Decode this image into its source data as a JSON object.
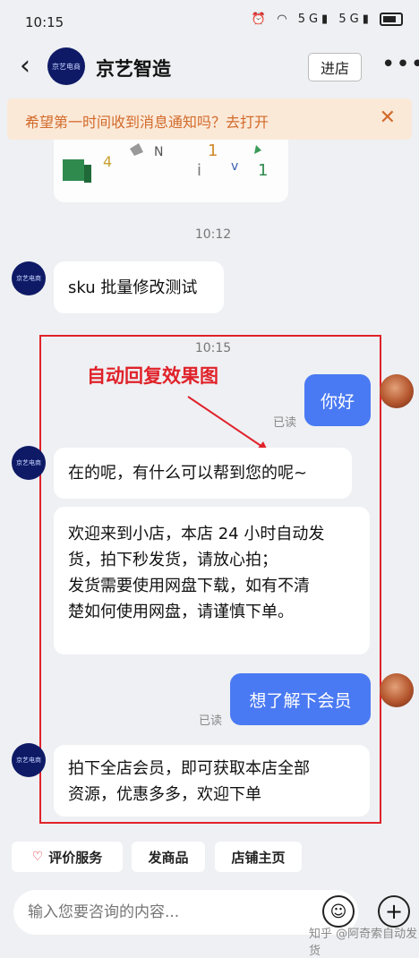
{
  "status": {
    "time": "10:15",
    "signal": "5G",
    "signal2": "5G"
  },
  "header": {
    "back": "‹",
    "shop_name": "京艺智造",
    "avatar_text": "京艺电商",
    "enter_label": "进店",
    "more": "•••"
  },
  "notify": {
    "text": "希望第一时间收到消息通知吗？去打开",
    "close": "✕"
  },
  "messages": {
    "ts1": "10:12",
    "msg1": "sku 批量修改测试",
    "ts2": "10:15",
    "me1": "你好",
    "read1": "已读",
    "reply1": "在的呢，有什么可以帮到您的呢~",
    "reply2_line1": "欢迎来到小店，本店 24 小时自动发",
    "reply2_line2": "货，拍下秒发货，请放心拍；",
    "reply2_line3": "发货需要使用网盘下载，如有不清",
    "reply2_line4": "楚如何使用网盘，请谨慎下单。",
    "me2": "想了解下会员",
    "read2": "已读",
    "reply3_line1": "拍下全店会员，即可获取本店全部",
    "reply3_line2": "资源，优惠多多，欢迎下单"
  },
  "annotation": "自动回复效果图",
  "quick_actions": {
    "review": "评价服务",
    "products": "发商品",
    "home": "店铺主页"
  },
  "input": {
    "placeholder": "输入您要咨询的内容..."
  },
  "watermark": "知乎 @阿奇索自动发货"
}
